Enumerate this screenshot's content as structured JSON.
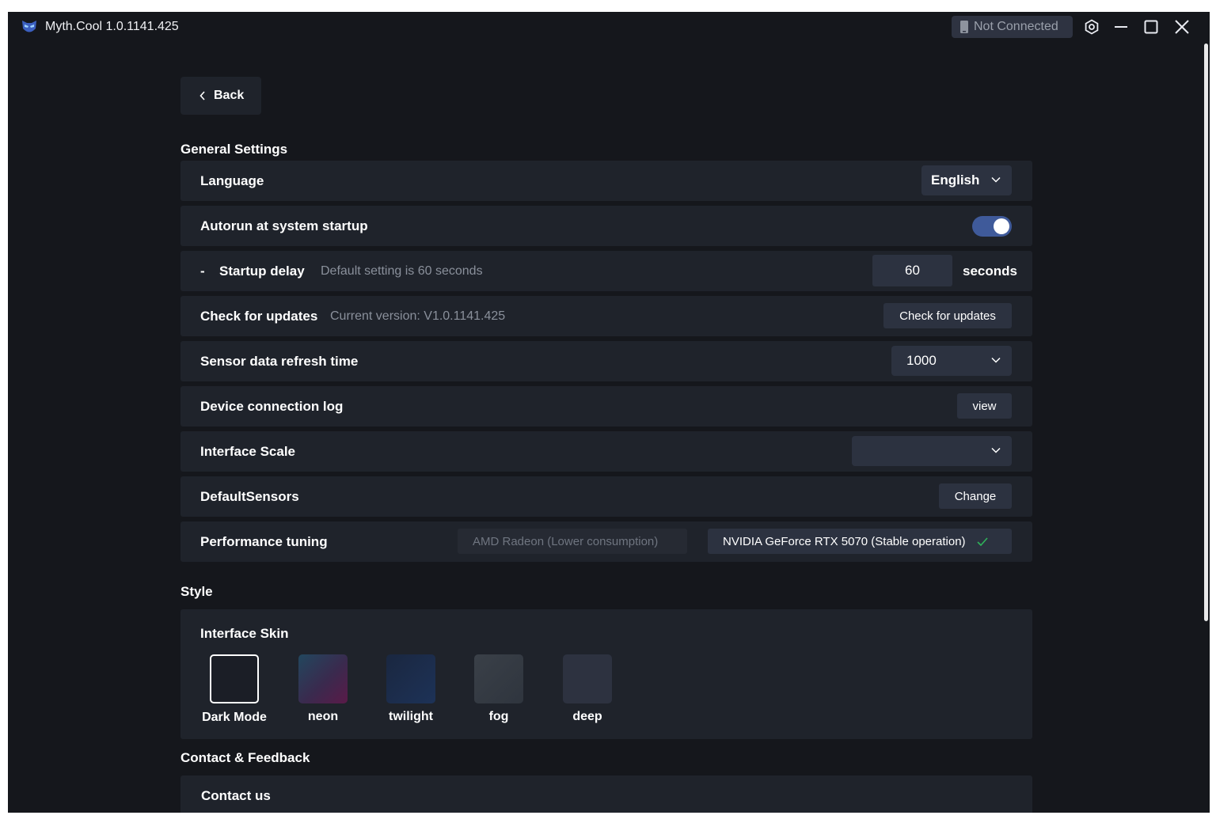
{
  "titlebar": {
    "app_title": "Myth.Cool  1.0.1141.425",
    "connection_status": "Not Connected",
    "icons": [
      "app-logo-icon",
      "phone-icon",
      "settings-icon",
      "minimize-icon",
      "maximize-icon",
      "close-icon"
    ]
  },
  "back": {
    "label": "Back"
  },
  "general": {
    "title": "General Settings",
    "language": {
      "label": "Language",
      "value": "English"
    },
    "autorun": {
      "label": "Autorun at system startup",
      "enabled": true
    },
    "startup_delay": {
      "prefix": "-",
      "label": "Startup delay",
      "hint": "Default setting is 60 seconds",
      "value": "60",
      "unit": "seconds"
    },
    "updates": {
      "label": "Check for updates",
      "hint": "Current version: V1.0.1141.425",
      "button": "Check for updates"
    },
    "refresh": {
      "label": "Sensor data refresh time",
      "value": "1000"
    },
    "log": {
      "label": "Device connection log",
      "button": "view"
    },
    "scale": {
      "label": "Interface Scale",
      "value": ""
    },
    "sensors": {
      "label": "DefaultSensors",
      "button": "Change"
    },
    "performance": {
      "label": "Performance tuning",
      "option_amd": "AMD Radeon  (Lower consumption)",
      "option_nvidia": "NVIDIA GeForce RTX 5070  (Stable operation)",
      "selected": "nvidia"
    }
  },
  "style": {
    "title": "Style",
    "skin_label": "Interface Skin",
    "skins": [
      {
        "name": "Dark Mode",
        "selected": true
      },
      {
        "name": "neon"
      },
      {
        "name": "twilight"
      },
      {
        "name": "fog"
      },
      {
        "name": "deep"
      }
    ]
  },
  "contact": {
    "title": "Contact & Feedback",
    "contact_us": "Contact us"
  },
  "colors": {
    "window_bg": "#15171c",
    "row_bg": "#1f232b",
    "control_bg": "#2c3240",
    "toggle_on": "#3f5a9a",
    "check_green": "#2fb35a"
  }
}
